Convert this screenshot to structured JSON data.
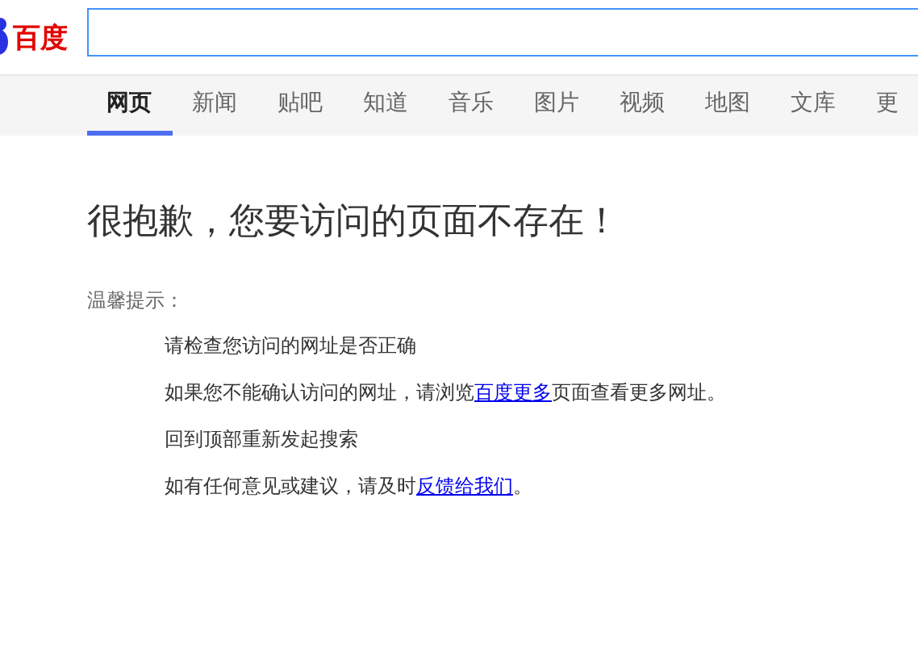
{
  "logo": {
    "text": "百度"
  },
  "tabs": [
    {
      "label": "网页",
      "selected": true
    },
    {
      "label": "新闻",
      "selected": false
    },
    {
      "label": "贴吧",
      "selected": false
    },
    {
      "label": "知道",
      "selected": false
    },
    {
      "label": "音乐",
      "selected": false
    },
    {
      "label": "图片",
      "selected": false
    },
    {
      "label": "视频",
      "selected": false
    },
    {
      "label": "地图",
      "selected": false
    },
    {
      "label": "文库",
      "selected": false
    },
    {
      "label": "更",
      "selected": false
    }
  ],
  "heading": "很抱歉，您要访问的页面不存在！",
  "tip_label": "温馨提示：",
  "tips": [
    {
      "parts": [
        {
          "kind": "text",
          "text": "请检查您访问的网址是否正确"
        }
      ]
    },
    {
      "parts": [
        {
          "kind": "text",
          "text": "如果您不能确认访问的网址，请浏览"
        },
        {
          "kind": "link",
          "text": "百度更多"
        },
        {
          "kind": "text",
          "text": "页面查看更多网址。"
        }
      ]
    },
    {
      "parts": [
        {
          "kind": "text",
          "text": "回到顶部重新发起搜索"
        }
      ]
    },
    {
      "parts": [
        {
          "kind": "text",
          "text": "如有任何意见或建议，请及时"
        },
        {
          "kind": "link",
          "text": "反馈给我们"
        },
        {
          "kind": "text",
          "text": "。"
        }
      ]
    }
  ]
}
